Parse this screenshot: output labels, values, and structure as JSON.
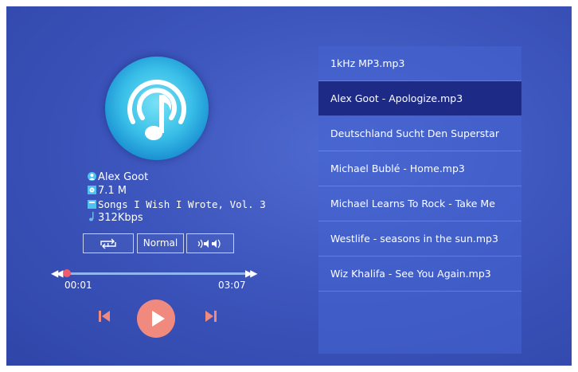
{
  "player": {
    "artist": "Alex  Goot",
    "file_size": "7.1 M",
    "album": "Songs I Wish I Wrote, Vol. 3",
    "bitrate": "312Kbps",
    "eq_mode": "Normal",
    "current_time": "00:01",
    "total_time": "03:07",
    "progress": 0.01,
    "accent_color": "#f05b6d"
  },
  "playlist": {
    "selected_index": 1,
    "items": [
      "1kHz MP3.mp3",
      "Alex  Goot - Apologize.mp3",
      "Deutschland Sucht Den Superstar",
      "Michael Bublé - Home.mp3",
      "Michael Learns To Rock - Take Me",
      "Westlife - seasons in the sun.mp3",
      "Wiz Khalifa - See You Again.mp3"
    ]
  }
}
